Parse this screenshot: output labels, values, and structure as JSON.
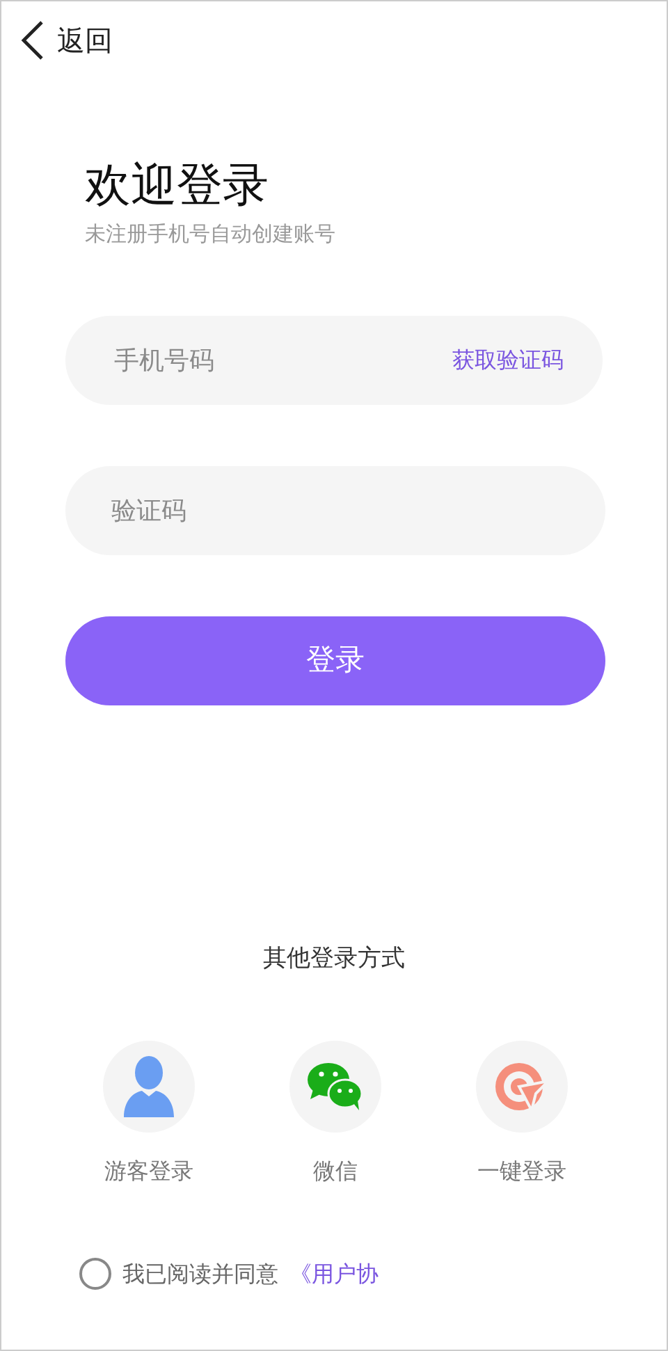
{
  "header": {
    "back_label": "返回"
  },
  "title": "欢迎登录",
  "subtitle": "未注册手机号自动创建账号",
  "phone_field": {
    "placeholder": "手机号码",
    "action": "获取验证码"
  },
  "code_field": {
    "placeholder": "验证码"
  },
  "login_button": "登录",
  "other_methods": {
    "heading": "其他登录方式",
    "items": [
      {
        "kind": "guest",
        "label": "游客登录"
      },
      {
        "kind": "wechat",
        "label": "微信"
      },
      {
        "kind": "onekey",
        "label": "一键登录"
      }
    ]
  },
  "agreement": {
    "checked": false,
    "text": "我已阅读并同意",
    "link": "《用户协"
  }
}
